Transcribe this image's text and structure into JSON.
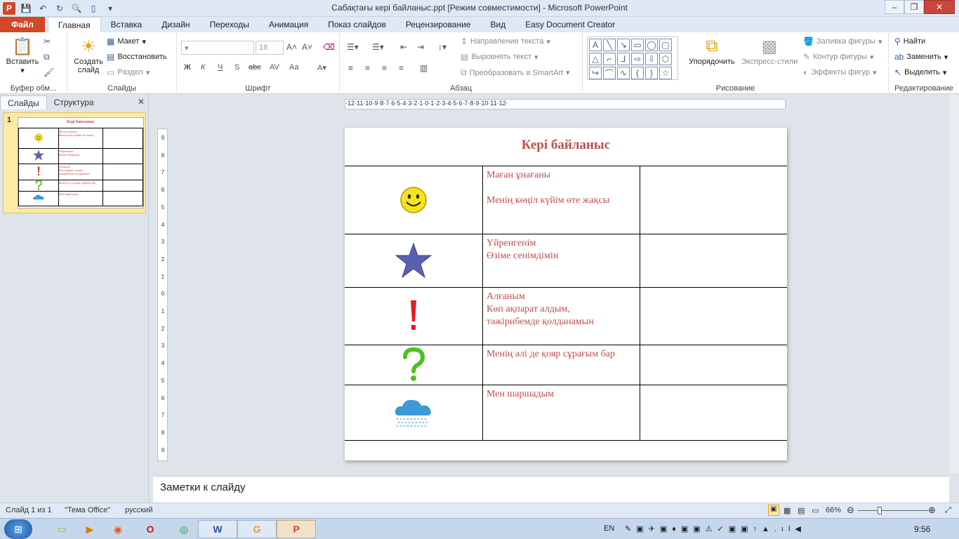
{
  "titlebar": {
    "title": "Сабақтағы кері байланыс.ppt [Режим совместимости]  -  Microsoft PowerPoint",
    "minimize": "–",
    "restore": "❐",
    "close": "✕"
  },
  "tabs": [
    "Файл",
    "Главная",
    "Вставка",
    "Дизайн",
    "Переходы",
    "Анимация",
    "Показ слайдов",
    "Рецензирование",
    "Вид",
    "Easy Document Creator"
  ],
  "ribbon": {
    "clipboard": {
      "paste": "Вставить",
      "label": "Буфер обм..."
    },
    "slides": {
      "new_slide_1": "Создать",
      "new_slide_2": "слайд",
      "layout": "Макет",
      "reset": "Восстановить",
      "section": "Раздел",
      "label": "Слайды"
    },
    "font": {
      "size": "18",
      "bold": "Ж",
      "italic": "К",
      "underline": "Ч",
      "strike": "abc",
      "spacing": "AV",
      "case": "Aa",
      "label": "Шрифт"
    },
    "paragraph": {
      "text_direction": "Направление текста",
      "align_text": "Выровнять текст",
      "smartart": "Преобразовать в SmartArt",
      "label": "Абзац"
    },
    "drawing": {
      "arrange": "Упорядочить",
      "quick_styles": "Экспресс-стили",
      "shape_fill": "Заливка фигуры",
      "shape_outline": "Контур фигуры",
      "shape_effects": "Эффекты фигур",
      "label": "Рисование"
    },
    "editing": {
      "find": "Найти",
      "replace": "Заменить",
      "select": "Выделить",
      "label": "Редактирование"
    }
  },
  "left_panel": {
    "tab_slides": "Слайды",
    "tab_outline": "Структура",
    "close": "✕",
    "slide_number": "1",
    "thumb_title": "Кері байланыс"
  },
  "slide": {
    "title": "Кері байланыс",
    "rows": [
      {
        "icon": "smiley-icon",
        "lines": [
          "Маған ұнағаны",
          "",
          "Менің көңіл күйім өте жақсы"
        ]
      },
      {
        "icon": "star-icon",
        "lines": [
          "Үйренгенім",
          "Өзіме сенімдімін"
        ]
      },
      {
        "icon": "exclamation-icon",
        "lines": [
          "Алғаным",
          "Көп ақпарат алдым,",
          "тәжірибемде қолданамын"
        ]
      },
      {
        "icon": "question-icon",
        "lines": [
          "Менің әлі де қояр сұрағым бар"
        ]
      },
      {
        "icon": "rain-cloud-icon",
        "lines": [
          "Мен шаршадым"
        ]
      }
    ]
  },
  "ruler": {
    "h": "·12·11·10·9·8·7·6·5·4·3·2·1·0·1·2·3·4·5·6·7·8·9·10·11·12·",
    "v": [
      "9",
      "8",
      "7",
      "6",
      "5",
      "4",
      "3",
      "2",
      "1",
      "0",
      "1",
      "2",
      "3",
      "4",
      "5",
      "6",
      "7",
      "8",
      "9"
    ]
  },
  "notes": {
    "placeholder": "Заметки к слайду"
  },
  "status": {
    "slide_of": "Слайд 1 из 1",
    "theme": "\"Тема Office\"",
    "language": "русский",
    "zoom": "66%"
  },
  "taskbar": {
    "lang": "EN",
    "time": "9:56"
  },
  "colors": {
    "accent": "#c0504d",
    "file_tab": "#d24726"
  }
}
